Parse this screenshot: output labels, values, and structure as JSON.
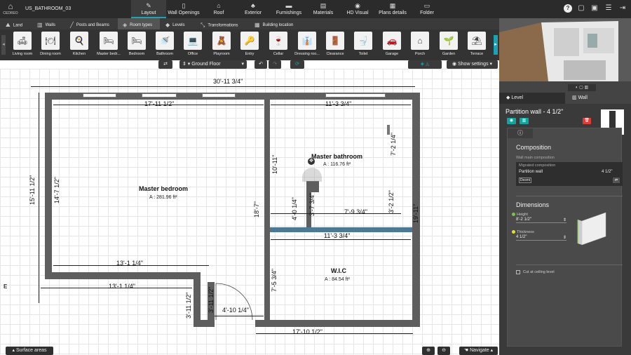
{
  "app": {
    "logo_text": "CEDREO",
    "project_name": "US_BATHROOM_03"
  },
  "main_tabs": [
    {
      "label": "Layout",
      "icon": "pencil-icon"
    },
    {
      "label": "Wall Openings",
      "icon": "door-icon"
    },
    {
      "label": "Roof",
      "icon": "roof-icon"
    },
    {
      "label": "Exterior",
      "icon": "tree-icon"
    },
    {
      "label": "Furnishings",
      "icon": "sofa-icon"
    },
    {
      "label": "Materials",
      "icon": "paint-roller-icon"
    },
    {
      "label": "HD Visual",
      "icon": "camera-icon"
    },
    {
      "label": "Plans details",
      "icon": "plan-icon"
    },
    {
      "label": "Folder",
      "icon": "folder-icon"
    }
  ],
  "sub_tabs": [
    {
      "label": "Land",
      "icon": "land-icon"
    },
    {
      "label": "Walls",
      "icon": "walls-icon"
    },
    {
      "label": "Posts and Beams",
      "icon": "beam-icon"
    },
    {
      "label": "Room types",
      "icon": "tag-icon"
    },
    {
      "label": "Levels",
      "icon": "layers-icon"
    },
    {
      "label": "Transformations",
      "icon": "transform-icon"
    },
    {
      "label": "Building location",
      "icon": "building-icon"
    }
  ],
  "room_types": [
    {
      "label": "Living room",
      "glyph": "🛋"
    },
    {
      "label": "Dining room",
      "glyph": "🍽"
    },
    {
      "label": "Kitchen",
      "glyph": "🍳"
    },
    {
      "label": "Master bedr...",
      "glyph": "🛏"
    },
    {
      "label": "Bedroom",
      "glyph": "🛏"
    },
    {
      "label": "Bathroom",
      "glyph": "🚿"
    },
    {
      "label": "Office",
      "glyph": "💻"
    },
    {
      "label": "Playroom",
      "glyph": "🧸"
    },
    {
      "label": "Entry",
      "glyph": "🔑"
    },
    {
      "label": "Cellar",
      "glyph": "🍷"
    },
    {
      "label": "Dressing roo...",
      "glyph": "👔"
    },
    {
      "label": "Clearance",
      "glyph": "🚪"
    },
    {
      "label": "Toilet",
      "glyph": "🚽"
    },
    {
      "label": "Garage",
      "glyph": "🚗"
    },
    {
      "label": "Porch",
      "glyph": "⌂"
    },
    {
      "label": "Garden",
      "glyph": "🌱"
    },
    {
      "label": "Terrace",
      "glyph": "⛱"
    }
  ],
  "toolbar": {
    "floor": "Ground Floor",
    "show_settings": "Show settings"
  },
  "plan": {
    "dims": {
      "overall_top": "30'-11 3/4\"",
      "bedroom_top": "17'-11 1/2\"",
      "bath_top": "11'-3 3/4\"",
      "bath_right": "7'-2 1/4\"",
      "left_overall": "15'-11 1/2\"",
      "bedroom_left": "14'-7 1/2\"",
      "bedroom_bottom": "13'-1 1/4\"",
      "outer_bottom_left": "13'-1 1/4\"",
      "partition_10": "10'-11\"",
      "partition_18": "18'-7\"",
      "bath_4": "4'-0 1/4\"",
      "bath_3_7": "3'-7 3/4\"",
      "bath_7_9": "7'-9 3/4\"",
      "bath_3_2": "3'-2 1/2\"",
      "right_19": "19'-11\"",
      "wic_top": "11'-3 3/4\"",
      "wic_left": "7'-5 3/4\"",
      "entry_3_11_a": "3'-11 1/2\"",
      "entry_3_11_b": "3'-11 1/2\"",
      "entry_4_10": "4'-10 1/4\"",
      "bottom_17": "17'-10 1/2\""
    },
    "rooms": [
      {
        "name": "Master bedroom",
        "area": "A : 281.96 ft²"
      },
      {
        "name": "Master bathroom",
        "area": "A : 116.76 ft²"
      },
      {
        "name": "W.I.C",
        "area": "A : 84.54 ft²"
      }
    ]
  },
  "bottom": {
    "surface_areas": "Surface areas",
    "navigate": "Navigate"
  },
  "right_panel": {
    "tabs": [
      "Level",
      "Wall"
    ],
    "title": "Partition wall - 4 1/2\"",
    "composition": {
      "heading": "Composition",
      "sublabel": "Wall main composition",
      "migrated": "Migrated composition",
      "name": "Partition wall",
      "value": "4 1/2\"",
      "btn": "Desmi"
    },
    "dimensions": {
      "heading": "Dimensions",
      "height_label": "Height",
      "height_value": "8'-2 1/2\"",
      "thickness_label": "Thickness",
      "thickness_value": "4 1/2\""
    },
    "cut_label": "Cut at ceiling level",
    "accent": "#12a5a0",
    "delete_color": "#e53935"
  }
}
